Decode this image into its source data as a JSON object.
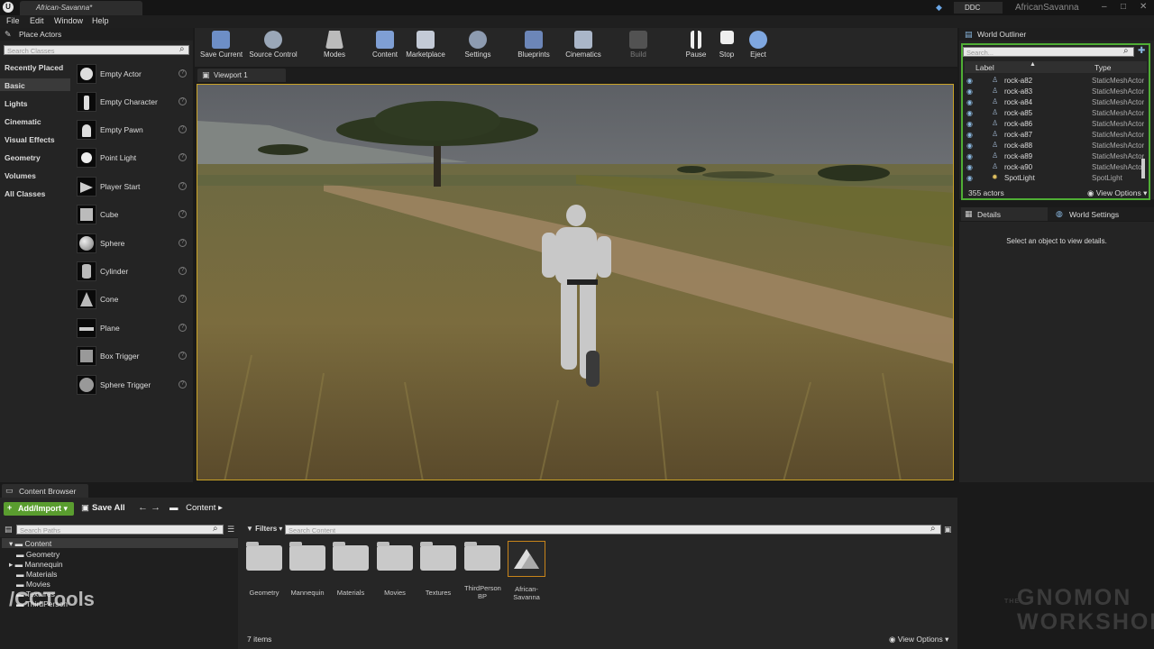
{
  "titlebar": {
    "doc_tab": "African-Savanna*",
    "ddc": "DDC",
    "app_title": "AfricanSavanna",
    "minimize": "–",
    "maximize": "□",
    "close": "✕"
  },
  "menu": [
    "File",
    "Edit",
    "Window",
    "Help"
  ],
  "place_actors": {
    "header": "Place Actors",
    "search_placeholder": "Search Classes",
    "categories": [
      "Recently Placed",
      "Basic",
      "Lights",
      "Cinematic",
      "Visual Effects",
      "Geometry",
      "Volumes",
      "All Classes"
    ],
    "selected_category": "Basic",
    "actors": [
      "Empty Actor",
      "Empty Character",
      "Empty Pawn",
      "Point Light",
      "Player Start",
      "Cube",
      "Sphere",
      "Cylinder",
      "Cone",
      "Plane",
      "Box Trigger",
      "Sphere Trigger"
    ]
  },
  "toolbar": {
    "items": [
      "Save Current",
      "Source Control",
      "Modes",
      "Content",
      "Marketplace",
      "Settings",
      "Blueprints",
      "Cinematics",
      "Build",
      "Pause",
      "Stop",
      "Eject"
    ]
  },
  "viewport": {
    "tab": "Viewport 1"
  },
  "world_outliner": {
    "header": "World Outliner",
    "search_placeholder": "Search...",
    "col_label": "Label",
    "col_type": "Type",
    "rows": [
      {
        "label": "rock-a82",
        "type": "StaticMeshActor"
      },
      {
        "label": "rock-a83",
        "type": "StaticMeshActor"
      },
      {
        "label": "rock-a84",
        "type": "StaticMeshActor"
      },
      {
        "label": "rock-a85",
        "type": "StaticMeshActor"
      },
      {
        "label": "rock-a86",
        "type": "StaticMeshActor"
      },
      {
        "label": "rock-a87",
        "type": "StaticMeshActor"
      },
      {
        "label": "rock-a88",
        "type": "StaticMeshActor"
      },
      {
        "label": "rock-a89",
        "type": "StaticMeshActor"
      },
      {
        "label": "rock-a90",
        "type": "StaticMeshActor"
      },
      {
        "label": "SpotLight",
        "type": "SpotLight"
      }
    ],
    "actor_count": "355 actors",
    "view_options": "View Options"
  },
  "details": {
    "tab_details": "Details",
    "tab_world_settings": "World Settings",
    "message": "Select an object to view details."
  },
  "content_browser": {
    "tab": "Content Browser",
    "add_import": "Add/Import",
    "save_all": "Save All",
    "breadcrumb": "Content",
    "paths_search_placeholder": "Search Paths",
    "filters": "Filters",
    "content_search_placeholder": "Search Content",
    "tree_root": "Content",
    "tree": [
      "Geometry",
      "Mannequin",
      "Materials",
      "Movies",
      "Textures",
      "ThirdPerson"
    ],
    "assets": [
      "Geometry",
      "Mannequin",
      "Materials",
      "Movies",
      "Textures",
      "ThirdPerson BP",
      "African-Savanna"
    ],
    "item_count": "7 items",
    "view_options": "View Options"
  },
  "watermarks": {
    "cctools": "/CCTools",
    "gnomon_line1": "GNOMON",
    "gnomon_line2": "WORKSHOP",
    "gnomon_prefix": "THE"
  },
  "colors": {
    "accent_green": "#4fae35",
    "add_import_green": "#5a9d2f",
    "viewport_border": "#c9a227"
  }
}
